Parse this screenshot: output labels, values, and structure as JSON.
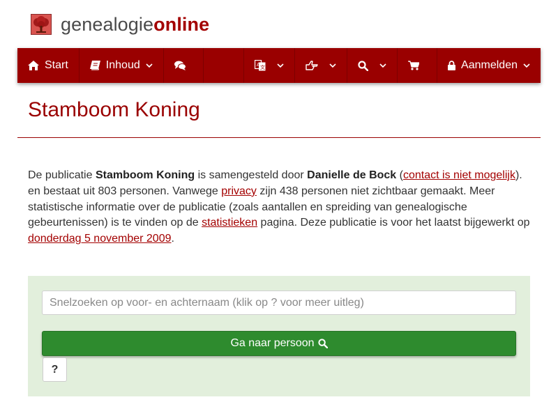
{
  "brand": {
    "text_plain": "genealogie",
    "text_accent": "online"
  },
  "nav": {
    "start_label": "Start",
    "inhoud_label": "Inhoud",
    "login_label": "Aanmelden",
    "icons": [
      "home-icon",
      "book-icon",
      "comments-icon",
      "language-icon",
      "hand-pointer-icon",
      "search-icon",
      "cart-icon",
      "lock-icon"
    ]
  },
  "page": {
    "title": "Stamboom Koning"
  },
  "intro": {
    "p1": "De publicatie ",
    "pub_name": "Stamboom Koning",
    "p2": " is samengesteld door ",
    "author": "Danielle de Bock",
    "p3": " (",
    "contact_link": "contact is niet mogelijk",
    "p4": "). en bestaat uit 803 personen. Vanwege ",
    "privacy_link": "privacy",
    "p5": " zijn 438 personen niet zichtbaar gemaakt. Meer statistische informatie over de publicatie (zoals aantallen en spreiding van genealogische gebeurtenissen) is te vinden op de ",
    "stats_link": "statistieken",
    "p6": " pagina. Deze publicatie is voor het laatst bijgewerkt op ",
    "date_link": "donderdag 5 november 2009",
    "p7": "."
  },
  "search": {
    "placeholder": "Snelzoeken op voor- en achternaam (klik op ? voor meer uitleg)",
    "go_label": "Ga naar persoon",
    "help_label": "?"
  },
  "colors": {
    "brand_red": "#9a0000",
    "go_green": "#2e8b2e",
    "panel_green": "#e2efdc"
  }
}
